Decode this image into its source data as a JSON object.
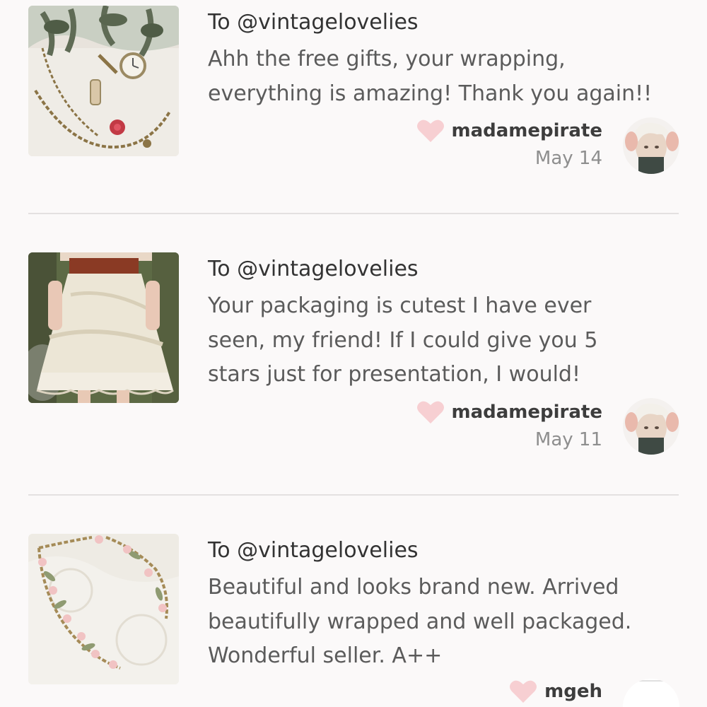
{
  "reviews": [
    {
      "recipient": "To @vintagelovelies",
      "text_lines": [
        "Ahh the free gifts, your wrapping,",
        "everything is amazing! Thank you again!!"
      ],
      "reviewer": "madamepirate",
      "date": "May 14",
      "thumbnail_icon": "necklace-photo"
    },
    {
      "recipient": "To @vintagelovelies",
      "text_lines": [
        "Your packaging is cutest I have ever",
        "seen, my friend! If I could give you 5",
        "stars just for presentation, I would!"
      ],
      "reviewer": "madamepirate",
      "date": "May 11",
      "thumbnail_icon": "skirt-photo"
    },
    {
      "recipient": "To @vintagelovelies",
      "text_lines": [
        "Beautiful and looks brand new. Arrived",
        "beautifully wrapped and well packaged.",
        "Wonderful seller. A++"
      ],
      "reviewer": "mgeh",
      "date": "",
      "thumbnail_icon": "floral-necklace-photo"
    }
  ],
  "colors": {
    "heart": "#f7cfd2",
    "divider": "#e4e1e1",
    "background": "#fbf9f9"
  }
}
